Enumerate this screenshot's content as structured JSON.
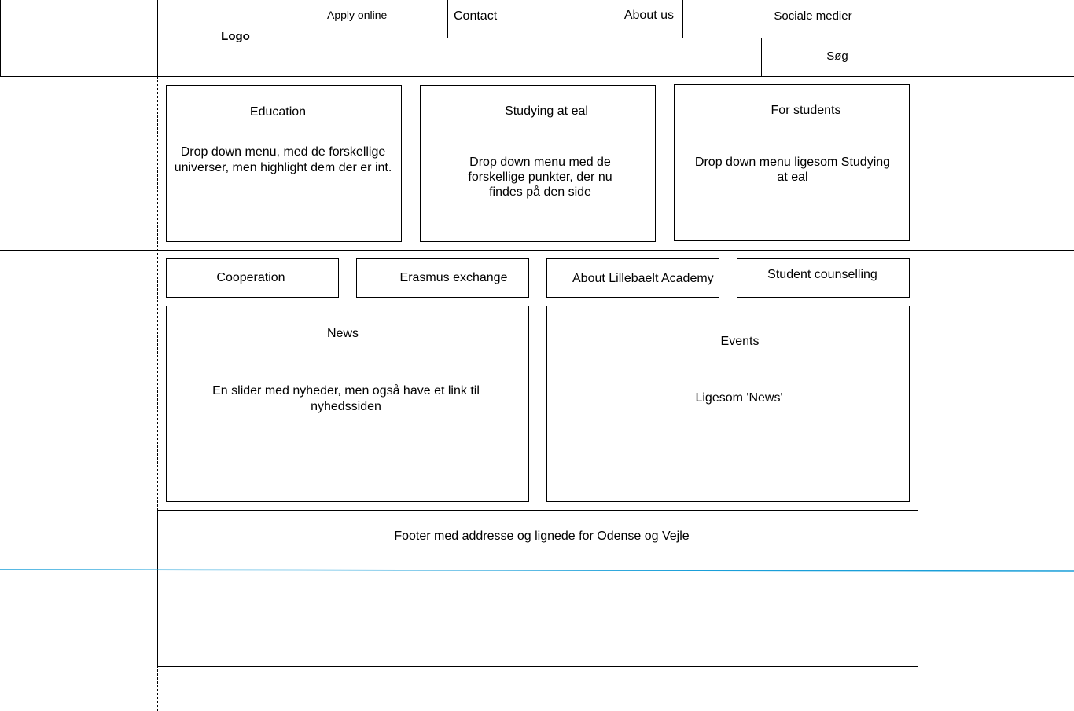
{
  "header": {
    "logo": "Logo",
    "nav": {
      "apply_online": "Apply online",
      "contact": "Contact",
      "about_us": "About us",
      "social_media": "Sociale medier",
      "search": "Søg"
    }
  },
  "main_menu": [
    {
      "title": "Education",
      "description": "Drop down menu, med de forskellige universer, men highlight dem der er int."
    },
    {
      "title": "Studying at eal",
      "description": "Drop down menu med de forskellige punkter, der nu findes på den side"
    },
    {
      "title": "For students",
      "description": "Drop down menu ligesom Studying at eal"
    }
  ],
  "quick_links": [
    "Cooperation",
    "Erasmus exchange",
    "About Lillebaelt Academy",
    "Student counselling"
  ],
  "news": {
    "title": "News",
    "description": "En slider med nyheder, men også have et link til nyhedssiden"
  },
  "events": {
    "title": "Events",
    "description": "Ligesom 'News'"
  },
  "footer": {
    "text": "Footer med addresse og lignede for Odense og Vejle"
  },
  "colors": {
    "guide_line": "#1a9fd9",
    "stroke": "#000000"
  }
}
